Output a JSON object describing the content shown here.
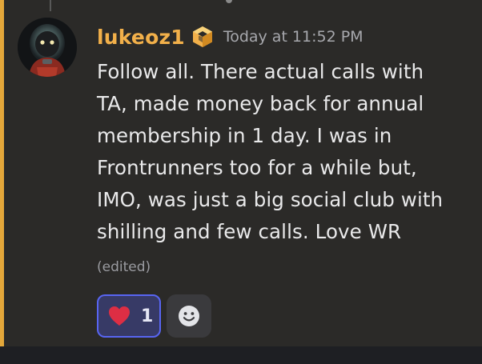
{
  "message": {
    "author": {
      "username": "lukeoz1",
      "username_color": "#f2b04a",
      "avatar_icon": "astronaut-avatar",
      "badge_icon": "gold-hexagon-badge-icon"
    },
    "timestamp": "Today at 11:52 PM",
    "lines": [
      "Follow all. There actual calls with",
      "TA, made money back for annual",
      "membership in 1 day.  I was in",
      "Frontrunners too for a while but,",
      "IMO, was just a big social club with",
      "shilling and few calls.  Love WR"
    ],
    "edited_label": "(edited)",
    "highlight_color": "#e3a73a"
  },
  "reactions": [
    {
      "emoji_icon": "red-heart-icon",
      "count": "1",
      "selected": true,
      "accent": "#5865f2"
    }
  ],
  "add_reaction": {
    "icon": "smiley-face-icon"
  }
}
